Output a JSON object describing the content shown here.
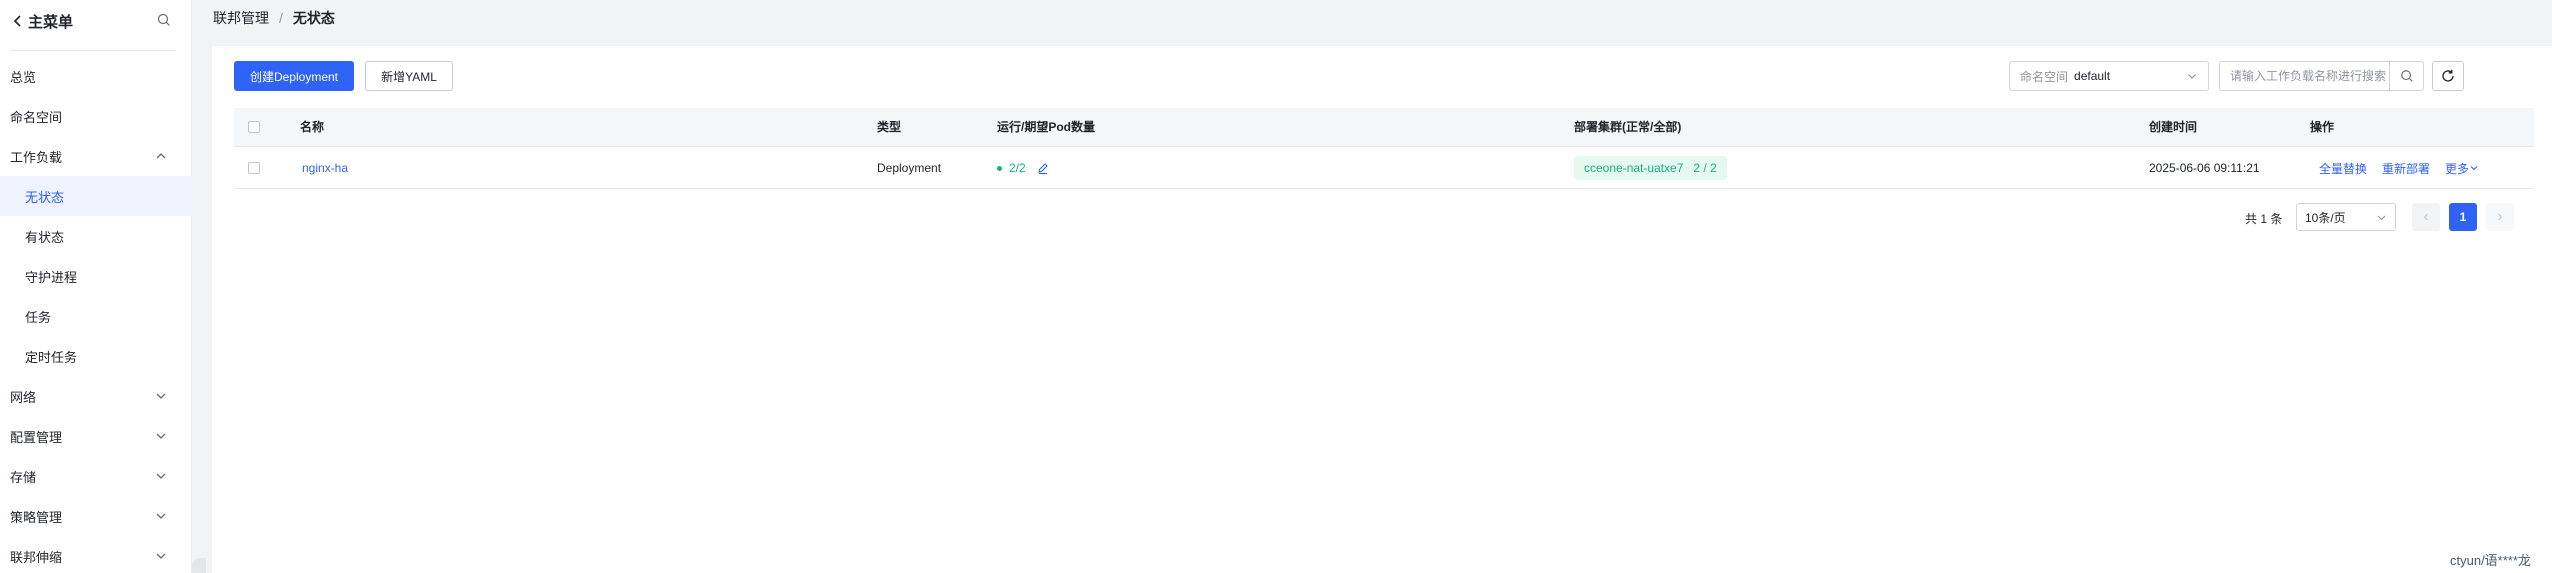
{
  "sidebar": {
    "back_label": "主菜单",
    "items": [
      {
        "label": "总览"
      },
      {
        "label": "命名空间"
      },
      {
        "label": "工作负载"
      },
      {
        "label": "无状态"
      },
      {
        "label": "有状态"
      },
      {
        "label": "守护进程"
      },
      {
        "label": "任务"
      },
      {
        "label": "定时任务"
      },
      {
        "label": "网络"
      },
      {
        "label": "配置管理"
      },
      {
        "label": "存储"
      },
      {
        "label": "策略管理"
      },
      {
        "label": "联邦伸缩"
      }
    ]
  },
  "breadcrumb": {
    "parent": "联邦管理",
    "separator": "/",
    "current": "无状态"
  },
  "toolbar": {
    "create_label": "创建Deployment",
    "yaml_label": "新增YAML",
    "namespace_label": "命名空间",
    "namespace_value": "default",
    "search_placeholder": "请输入工作负载名称进行搜索"
  },
  "table": {
    "columns": [
      "名称",
      "类型",
      "运行/期望Pod数量",
      "部署集群(正常/全部)",
      "创建时间",
      "操作"
    ],
    "rows": [
      {
        "name": "nginx-ha",
        "type": "Deployment",
        "pods": "2/2",
        "cluster": "cceone-nat-uatxe7",
        "cluster_count": "2 / 2",
        "created": "2025-06-06 09:11:21",
        "actions": [
          "全量替换",
          "重新部署",
          "更多"
        ]
      }
    ]
  },
  "pagination": {
    "total": "共 1 条",
    "page_size": "10条/页",
    "current_page": "1"
  },
  "user": "ctyun/语****龙",
  "colors": {
    "primary": "#2e63f5",
    "success": "#16b47a",
    "active_bg": "#eef3ff"
  }
}
